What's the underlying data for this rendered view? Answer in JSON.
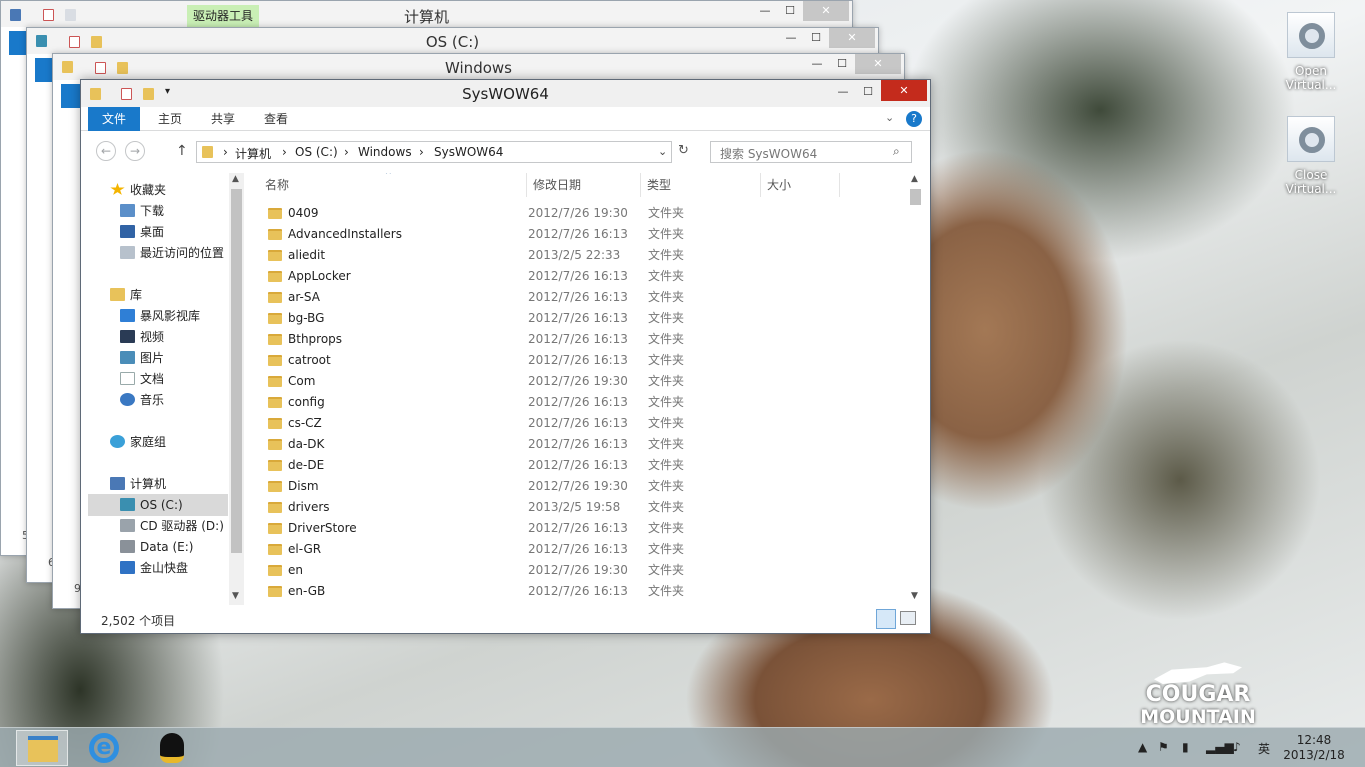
{
  "windows_behind": [
    {
      "title": "计算机",
      "context_tab": "驱动器工具"
    },
    {
      "title": "OS (C:)"
    },
    {
      "title": "Windows"
    }
  ],
  "behind_fragments": [
    "5",
    "6",
    "9"
  ],
  "window": {
    "title": "SysWOW64",
    "controls": {
      "minimize": "—",
      "maximize": "☐",
      "close": "✕"
    },
    "ribbon_tabs": [
      "文件",
      "主页",
      "共享",
      "查看"
    ],
    "address": {
      "path": [
        "计算机",
        "OS (C:)",
        "Windows",
        "SysWOW64"
      ],
      "sep": "›"
    },
    "search_placeholder": "搜索 SysWOW64",
    "nav": {
      "favorites": {
        "label": "收藏夹",
        "items": [
          "下载",
          "桌面",
          "最近访问的位置"
        ]
      },
      "library": {
        "label": "库",
        "items": [
          "暴风影视库",
          "视频",
          "图片",
          "文档",
          "音乐"
        ]
      },
      "homegroup": "家庭组",
      "computer": {
        "label": "计算机",
        "items": [
          "OS (C:)",
          "CD 驱动器 (D:)",
          "Data (E:)",
          "金山快盘"
        ]
      }
    },
    "columns": [
      "名称",
      "修改日期",
      "类型",
      "大小"
    ],
    "files": [
      {
        "name": "0409",
        "date": "2012/7/26 19:30",
        "type": "文件夹"
      },
      {
        "name": "AdvancedInstallers",
        "date": "2012/7/26 16:13",
        "type": "文件夹"
      },
      {
        "name": "aliedit",
        "date": "2013/2/5 22:33",
        "type": "文件夹"
      },
      {
        "name": "AppLocker",
        "date": "2012/7/26 16:13",
        "type": "文件夹"
      },
      {
        "name": "ar-SA",
        "date": "2012/7/26 16:13",
        "type": "文件夹"
      },
      {
        "name": "bg-BG",
        "date": "2012/7/26 16:13",
        "type": "文件夹"
      },
      {
        "name": "Bthprops",
        "date": "2012/7/26 16:13",
        "type": "文件夹"
      },
      {
        "name": "catroot",
        "date": "2012/7/26 16:13",
        "type": "文件夹"
      },
      {
        "name": "Com",
        "date": "2012/7/26 19:30",
        "type": "文件夹"
      },
      {
        "name": "config",
        "date": "2012/7/26 16:13",
        "type": "文件夹"
      },
      {
        "name": "cs-CZ",
        "date": "2012/7/26 16:13",
        "type": "文件夹"
      },
      {
        "name": "da-DK",
        "date": "2012/7/26 16:13",
        "type": "文件夹"
      },
      {
        "name": "de-DE",
        "date": "2012/7/26 16:13",
        "type": "文件夹"
      },
      {
        "name": "Dism",
        "date": "2012/7/26 19:30",
        "type": "文件夹"
      },
      {
        "name": "drivers",
        "date": "2013/2/5 19:58",
        "type": "文件夹"
      },
      {
        "name": "DriverStore",
        "date": "2012/7/26 16:13",
        "type": "文件夹"
      },
      {
        "name": "el-GR",
        "date": "2012/7/26 16:13",
        "type": "文件夹"
      },
      {
        "name": "en",
        "date": "2012/7/26 19:30",
        "type": "文件夹"
      },
      {
        "name": "en-GB",
        "date": "2012/7/26 16:13",
        "type": "文件夹"
      }
    ],
    "status": "2,502 个项目"
  },
  "desktop_icons": [
    {
      "label": "Open Virtual..."
    },
    {
      "label": "Close Virtual..."
    }
  ],
  "brand": {
    "line1": "COUGAR",
    "line2": "MOUNTAIN"
  },
  "taskbar": {
    "time": "12:48",
    "date": "2013/2/18",
    "ime": "英"
  },
  "colors": {
    "accent": "#1979ca",
    "close": "#c42b1c",
    "selected": "#cce8ff"
  }
}
